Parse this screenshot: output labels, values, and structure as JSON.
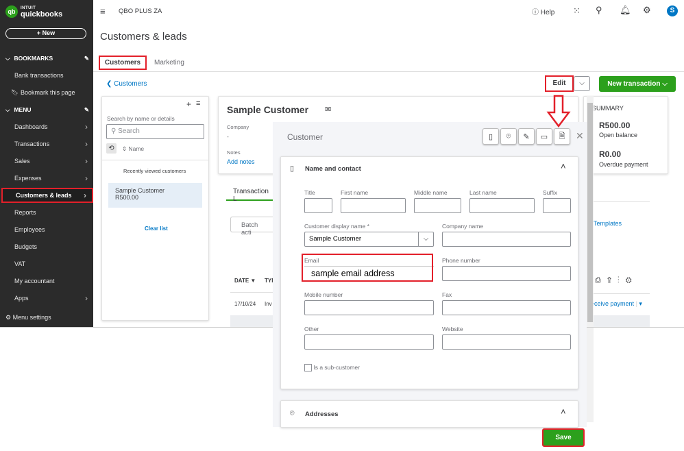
{
  "app": {
    "brand_top": "INTUIT",
    "brand": "quickbooks",
    "new_label": "+ New",
    "company": "QBO PLUS ZA",
    "help": "Help",
    "avatar": "S"
  },
  "sidebar": {
    "bookmarks_label": "BOOKMARKS",
    "bookmarks": [
      "Bank transactions",
      "Bookmark this page"
    ],
    "menu_label": "MENU",
    "items": [
      {
        "label": "Dashboards",
        "chev": true
      },
      {
        "label": "Transactions",
        "chev": true
      },
      {
        "label": "Sales",
        "chev": true
      },
      {
        "label": "Expenses",
        "chev": true
      },
      {
        "label": "Customers & leads",
        "chev": true,
        "active": true
      },
      {
        "label": "Reports"
      },
      {
        "label": "Employees"
      },
      {
        "label": "Budgets"
      },
      {
        "label": "VAT"
      },
      {
        "label": "My accountant"
      },
      {
        "label": "Apps",
        "chev": true
      }
    ],
    "settings": "Menu settings"
  },
  "page": {
    "title": "Customers & leads",
    "tabs": [
      "Customers",
      "Marketing"
    ],
    "back": "Customers",
    "edit": "Edit",
    "new_transaction": "New transaction"
  },
  "list": {
    "search_hint": "Search by name or details",
    "search_placeholder": "Search",
    "sort": "Name",
    "recent": "Recently viewed customers",
    "customer_name": "Sample Customer",
    "customer_balance": "R500.00",
    "clear": "Clear list"
  },
  "detail": {
    "name": "Sample Customer",
    "company_label": "Company",
    "company_value": "-",
    "notes_label": "Notes",
    "add_notes": "Add notes",
    "tab": "Transaction L",
    "batch": "Batch acti",
    "col_date": "DATE ▼",
    "col_type": "TYI",
    "row_date": "17/10/24",
    "row_type": "Inv"
  },
  "summary": {
    "title": "SUMMARY",
    "open_amount": "R500.00",
    "open_label": "Open balance",
    "overdue_amount": "R0.00",
    "overdue_label": "Overdue payment",
    "templates": "Templates",
    "receive": "eceive payment"
  },
  "dialog": {
    "title": "Customer",
    "section": "Name and contact",
    "labels": {
      "title": "Title",
      "first": "First name",
      "middle": "Middle name",
      "last": "Last name",
      "suffix": "Suffix",
      "display": "Customer display name *",
      "company": "Company name",
      "email": "Email",
      "phone": "Phone number",
      "mobile": "Mobile number",
      "fax": "Fax",
      "other": "Other",
      "website": "Website",
      "sub": "Is a sub-customer"
    },
    "display_value": "Sample Customer",
    "email_value": "sample email address",
    "addresses": "Addresses",
    "save": "Save"
  },
  "colors": {
    "green": "#2ca01c",
    "red": "#e3202a",
    "link": "#0077c5",
    "sidebar": "#2b2b2b"
  }
}
